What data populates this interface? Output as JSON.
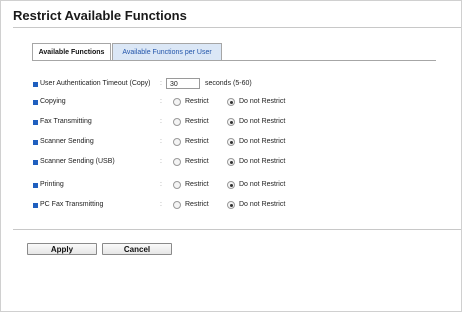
{
  "page": {
    "title": "Restrict Available Functions"
  },
  "tabs": [
    {
      "label": "Available Functions",
      "active": true
    },
    {
      "label": "Available Functions per User",
      "active": false
    }
  ],
  "timeout": {
    "label": "User Authentication Timeout (Copy)",
    "separator": ":",
    "value": "30",
    "unit": "seconds (5-60)"
  },
  "functions": [
    {
      "label": "Copying",
      "separator": ":",
      "restrict_label": "Restrict",
      "no_restrict_label": "Do not Restrict",
      "selected": "Do not Restrict"
    },
    {
      "label": "Fax Transmitting",
      "separator": ":",
      "restrict_label": "Restrict",
      "no_restrict_label": "Do not Restrict",
      "selected": "Do not Restrict"
    },
    {
      "label": "Scanner Sending",
      "separator": ":",
      "restrict_label": "Restrict",
      "no_restrict_label": "Do not Restrict",
      "selected": "Do not Restrict"
    },
    {
      "label": "Scanner Sending (USB)",
      "separator": ":",
      "restrict_label": "Restrict",
      "no_restrict_label": "Do not Restrict",
      "selected": "Do not Restrict"
    },
    {
      "label": "Printing",
      "separator": ":",
      "restrict_label": "Restrict",
      "no_restrict_label": "Do not Restrict",
      "selected": "Do not Restrict"
    },
    {
      "label": "PC Fax Transmitting",
      "separator": ":",
      "restrict_label": "Restrict",
      "no_restrict_label": "Do not Restrict",
      "selected": "Do not Restrict"
    }
  ],
  "buttons": {
    "apply_label": "Apply",
    "cancel_label": "Cancel"
  },
  "colors": {
    "bullet": "#1f5fbf",
    "inactive_tab_bg": "#dbe7f6",
    "inactive_tab_text": "#2255aa"
  }
}
